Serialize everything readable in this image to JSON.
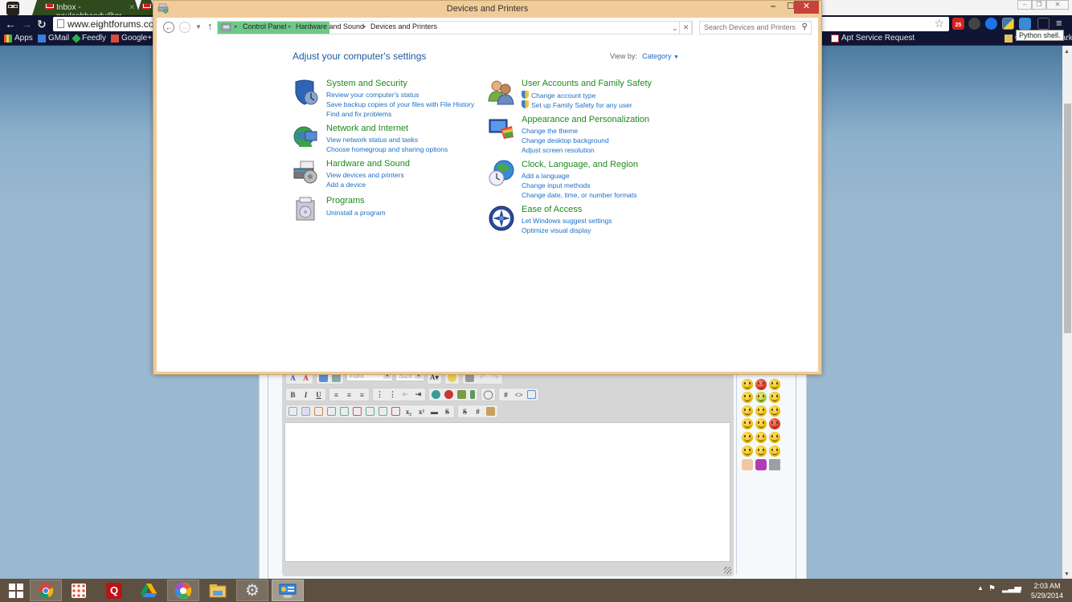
{
  "chrome": {
    "tabs": [
      {
        "label": "Inbox - paulashbandy@gr",
        "favicon": "gmail-icon"
      },
      {
        "label": "",
        "favicon": "gmail-icon"
      }
    ],
    "url": "www.eightforums.com",
    "bookmarks": [
      {
        "label": "Apps",
        "icon": "apps-grid-icon"
      },
      {
        "label": "GMail",
        "icon": "gmail-icon"
      },
      {
        "label": "Feedly",
        "icon": "feedly-icon"
      },
      {
        "label": "Google+",
        "icon": "google-plus-icon"
      },
      {
        "label": "Apt Service Request",
        "icon": "chart-icon"
      },
      {
        "label": "Other bookmarks",
        "icon": "folder-icon"
      }
    ],
    "extension_badge": "25",
    "tooltip": "Python shell."
  },
  "explorer": {
    "title": "Devices and Printers",
    "breadcrumbs": [
      "Control Panel",
      "Hardware and Sound",
      "Devices and Printers"
    ],
    "search_placeholder": "Search Devices and Printers",
    "heading": "Adjust your computer's settings",
    "view_by_label": "View by:",
    "view_by_value": "Category",
    "categories_left": [
      {
        "title": "System and Security",
        "icon": "shield-clock-icon",
        "links": [
          "Review your computer's status",
          "Save backup copies of your files with File History",
          "Find and fix problems"
        ]
      },
      {
        "title": "Network and Internet",
        "icon": "globe-network-icon",
        "links": [
          "View network status and tasks",
          "Choose homegroup and sharing options"
        ]
      },
      {
        "title": "Hardware and Sound",
        "icon": "printer-speaker-icon",
        "links": [
          "View devices and printers",
          "Add a device"
        ]
      },
      {
        "title": "Programs",
        "icon": "programs-box-icon",
        "links": [
          "Uninstall a program"
        ]
      }
    ],
    "categories_right": [
      {
        "title": "User Accounts and Family Safety",
        "icon": "users-icon",
        "links": [
          "Change account type",
          "Set up Family Safety for any user"
        ],
        "shield_links": true
      },
      {
        "title": "Appearance and Personalization",
        "icon": "monitor-palette-icon",
        "links": [
          "Change the theme",
          "Change desktop background",
          "Adjust screen resolution"
        ]
      },
      {
        "title": "Clock, Language, and Region",
        "icon": "globe-clock-icon",
        "links": [
          "Add a language",
          "Change input methods",
          "Change date, time, or number formats"
        ]
      },
      {
        "title": "Ease of Access",
        "icon": "ease-of-access-icon",
        "links": [
          "Let Windows suggest settings",
          "Optimize visual display"
        ]
      }
    ]
  },
  "editor": {
    "font_placeholder": "Font",
    "size_placeholder": "Size"
  },
  "taskbar": {
    "apps": [
      "start",
      "chrome",
      "apps-grid",
      "quicken",
      "google-drive",
      "picasa",
      "file-explorer",
      "control-panel-settings",
      "devices-and-printers"
    ],
    "time": "2:03 AM",
    "date": "5/29/2014"
  }
}
